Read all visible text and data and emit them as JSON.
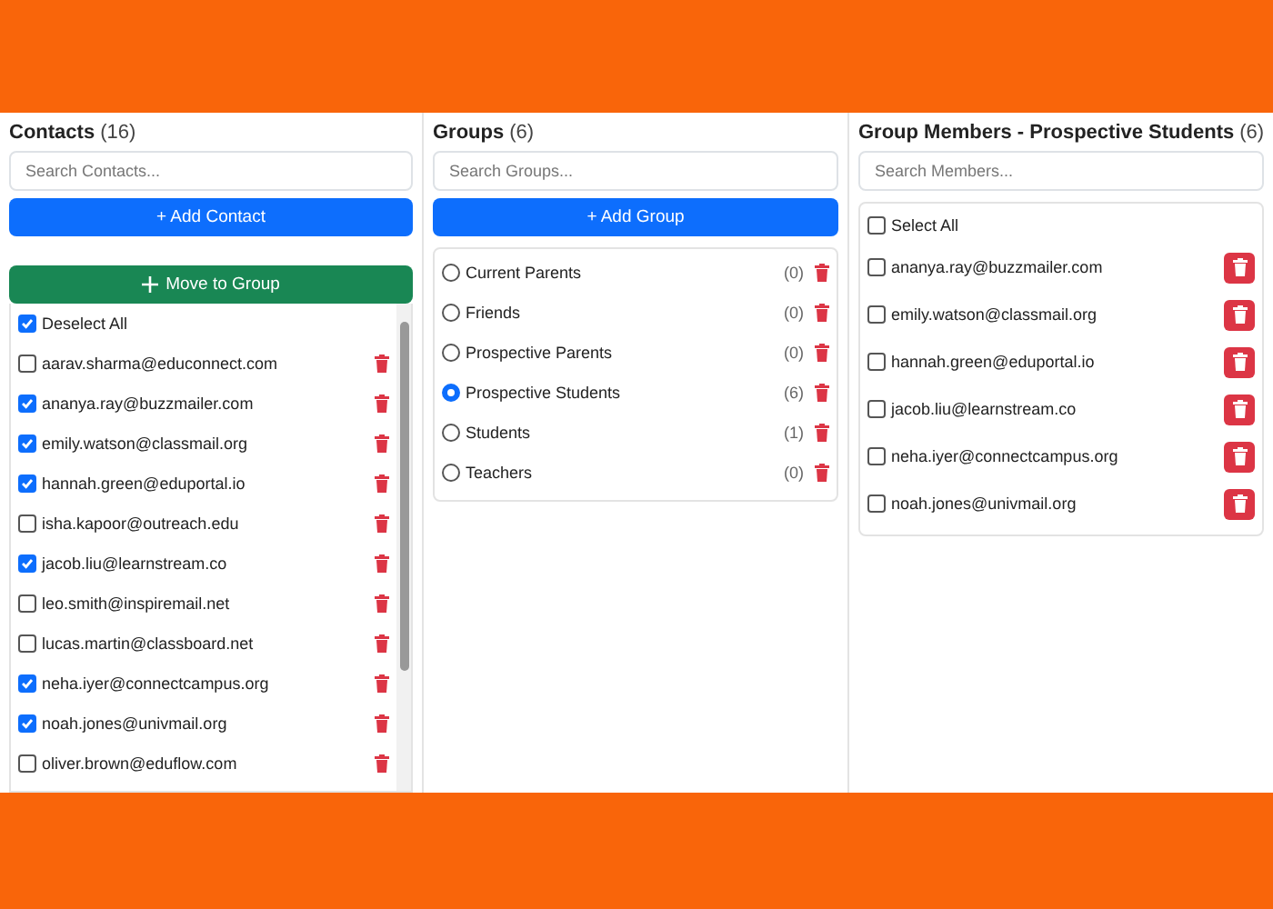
{
  "contacts": {
    "title": "Contacts",
    "count": "(16)",
    "search": {
      "placeholder": "Search Contacts..."
    },
    "add_button": "+ Add Contact",
    "move_button": "Move to Group",
    "select_all": {
      "label": "Deselect All",
      "checked": true
    },
    "items": [
      {
        "email": "aarav.sharma@educonnect.com",
        "checked": false
      },
      {
        "email": "ananya.ray@buzzmailer.com",
        "checked": true
      },
      {
        "email": "emily.watson@classmail.org",
        "checked": true
      },
      {
        "email": "hannah.green@eduportal.io",
        "checked": true
      },
      {
        "email": "isha.kapoor@outreach.edu",
        "checked": false
      },
      {
        "email": "jacob.liu@learnstream.co",
        "checked": true
      },
      {
        "email": "leo.smith@inspiremail.net",
        "checked": false
      },
      {
        "email": "lucas.martin@classboard.net",
        "checked": false
      },
      {
        "email": "neha.iyer@connectcampus.org",
        "checked": true
      },
      {
        "email": "noah.jones@univmail.org",
        "checked": true
      },
      {
        "email": "oliver.brown@eduflow.com",
        "checked": false
      }
    ]
  },
  "groups": {
    "title": "Groups",
    "count": "(6)",
    "search": {
      "placeholder": "Search Groups..."
    },
    "add_button": "+ Add Group",
    "items": [
      {
        "name": "Current Parents",
        "count": "(0)",
        "selected": false
      },
      {
        "name": "Friends",
        "count": "(0)",
        "selected": false
      },
      {
        "name": "Prospective Parents",
        "count": "(0)",
        "selected": false
      },
      {
        "name": "Prospective Students",
        "count": "(6)",
        "selected": true
      },
      {
        "name": "Students",
        "count": "(1)",
        "selected": false
      },
      {
        "name": "Teachers",
        "count": "(0)",
        "selected": false
      }
    ]
  },
  "members": {
    "title": "Group Members - Prospective Students",
    "count": "(6)",
    "search": {
      "placeholder": "Search Members..."
    },
    "select_all": {
      "label": "Select All",
      "checked": false
    },
    "items": [
      {
        "email": "ananya.ray@buzzmailer.com",
        "checked": false
      },
      {
        "email": "emily.watson@classmail.org",
        "checked": false
      },
      {
        "email": "hannah.green@eduportal.io",
        "checked": false
      },
      {
        "email": "jacob.liu@learnstream.co",
        "checked": false
      },
      {
        "email": "neha.iyer@connectcampus.org",
        "checked": false
      },
      {
        "email": "noah.jones@univmail.org",
        "checked": false
      }
    ]
  }
}
